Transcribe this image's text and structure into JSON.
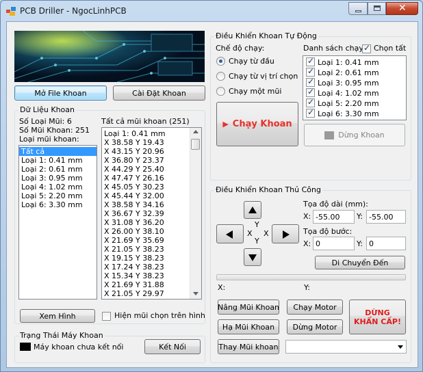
{
  "window": {
    "title": "PCB Driller - NgocLinhPCB"
  },
  "left": {
    "open_button": "Mở File Khoan",
    "settings_button": "Cài Đặt Khoan",
    "drill_data": {
      "group_label": "Dữ Liệu Khoan",
      "bit_types_count": "Số Loại Mũi: 6",
      "bit_count": "Số Mũi Khoan: 251",
      "bit_type_label": "Loại mũi khoan:",
      "bit_types": [
        "Tất cả",
        "Loại 1: 0.41 mm",
        "Loại 2: 0.61 mm",
        "Loại 3: 0.95 mm",
        "Loại 4: 1.02 mm",
        "Loại 5: 2.20 mm",
        "Loại 6: 3.30 mm"
      ],
      "selected_bit_type": "Tất cả",
      "all_bits_label": "Tất cả mũi khoan (251)",
      "all_bits": [
        "Loại 1: 0.41 mm",
        "X 38.58  Y 19.43",
        "X 43.15  Y 20.96",
        "X 36.80  Y 23.37",
        "X 44.29  Y 25.40",
        "X 47.47  Y 26.16",
        "X 45.05  Y 30.23",
        "X 45.44  Y 32.00",
        "X 38.58  Y 34.16",
        "X 36.67  Y 32.39",
        "X 31.08  Y 36.20",
        "X 26.00  Y 38.10",
        "X 21.69  Y 35.69",
        "X 21.05  Y 38.23",
        "X 19.15  Y 38.23",
        "X 17.24  Y 38.23",
        "X 15.34  Y 38.23",
        "X 21.69  Y 31.88",
        "X 21.05  Y 29.97"
      ],
      "view_button": "Xem Hình",
      "show_selected_label": "Hiện mũi chọn trên hình"
    },
    "machine": {
      "group_label": "Trạng Thái Máy Khoan",
      "status_text": "Máy khoan chưa kết nối",
      "connect_button": "Kết Nối"
    }
  },
  "auto": {
    "group_label": "Điều Khiển Khoan Tự Động",
    "mode_label": "Chế độ chạy:",
    "modes": [
      "Chạy từ đầu",
      "Chạy từ vị trí chọn",
      "Chạy một mũi"
    ],
    "selected_mode": "Chạy từ đầu",
    "run_list_label": "Danh sách chạy:",
    "select_all_label": "Chọn tất",
    "run_list": [
      "Loại 1: 0.41 mm",
      "Loại 2: 0.61 mm",
      "Loại 3: 0.95 mm",
      "Loại 4: 1.02 mm",
      "Loại 5: 2.20 mm",
      "Loại 6: 3.30 mm"
    ],
    "run_button": "Chạy Khoan",
    "run_button_icon": "play-triangle-icon",
    "stop_button": "Dừng Khoan",
    "accent_color": "#e8312a"
  },
  "manual": {
    "group_label": "Điều Khiển Khoan Thủ Công",
    "axis_x": "X",
    "axis_y": "Y",
    "coord_label": "Tọa độ dài (mm):",
    "x_label": "X:",
    "y_label": "Y:",
    "x_value": "-55.00",
    "y_value": "-55.00",
    "step_label": "Tọa độ bước:",
    "step_x_value": "0",
    "step_y_value": "0",
    "move_button": "Di Chuyển Đến",
    "pos_x_label": "X:",
    "pos_y_label": "Y:",
    "raise_button": "Nâng Mũi Khoan",
    "lower_button": "Hạ Mũi Khoan",
    "change_button": "Thay Mũi khoan",
    "run_motor_button": "Chạy Motor",
    "stop_motor_button": "Dừng Motor",
    "emergency_line1": "DỪNG",
    "emergency_line2": "KHẨN CẤP!",
    "emergency_color": "#e01b1b"
  }
}
